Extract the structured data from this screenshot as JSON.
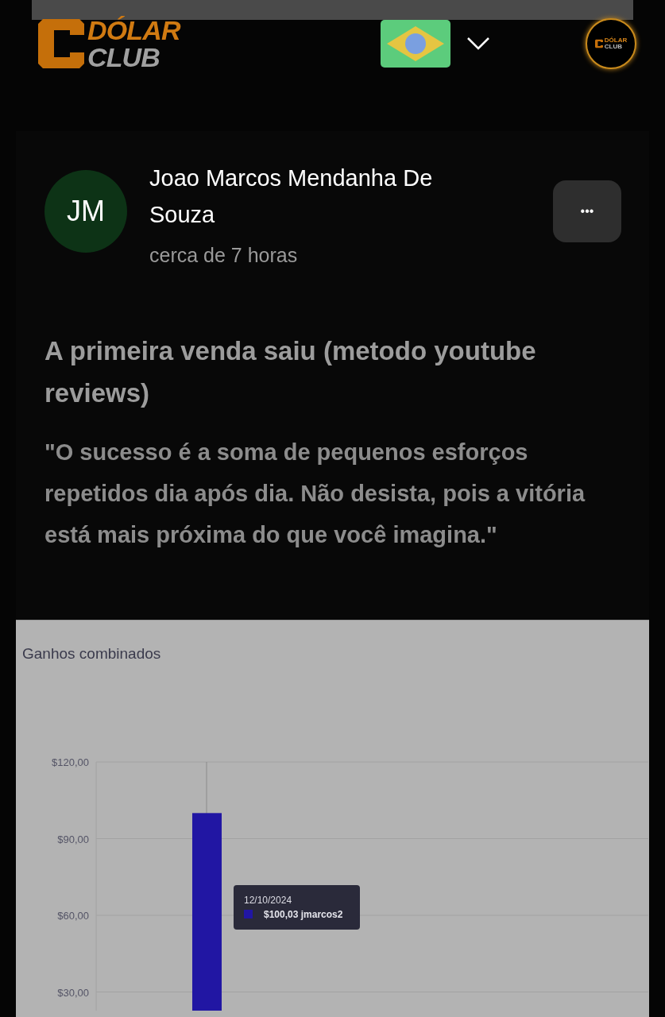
{
  "header": {
    "logo": {
      "top": "DÓLAR",
      "bottom": "CLUB"
    },
    "profile_logo": {
      "top": "DÓLAR",
      "bottom": "CLUB"
    }
  },
  "post": {
    "avatar": "JM",
    "author": "Joao Marcos Mendanha De Souza",
    "time": "cerca de 7 horas",
    "more": "•••",
    "title": "A primeira venda saiu (metodo youtube reviews)",
    "quote": "\"O sucesso é a soma de pequenos esforços repetidos dia após dia. Não desista, pois a vitória está mais próxima do que você imagina.\""
  },
  "chart": {
    "title": "Ganhos combinados",
    "tooltip": {
      "date": "12/10/2024",
      "value": "$100,03 jmarcos2"
    },
    "chart_data": {
      "type": "bar",
      "series": [
        {
          "color": "#2116a3",
          "values": [
            100
          ]
        }
      ],
      "grid": true,
      "ylim": [
        0,
        120
      ],
      "yticks": [
        {
          "value": 30,
          "label": "$30,00"
        },
        {
          "value": 60,
          "label": "$60,00"
        },
        {
          "value": 90,
          "label": "$90,00"
        },
        {
          "value": 120,
          "label": "$120,00"
        }
      ]
    }
  }
}
